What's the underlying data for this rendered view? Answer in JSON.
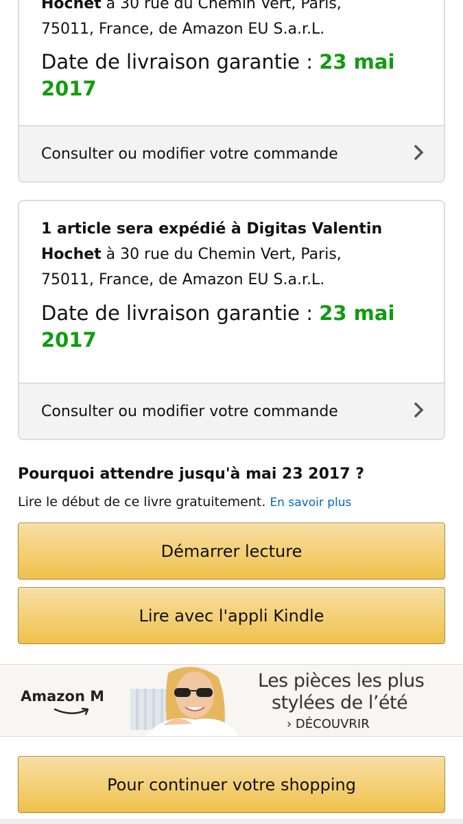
{
  "shipment_1": {
    "line_1_bold": "Hochet",
    "line_1_rest": " à 30 rue du Chemin Vert, Paris,",
    "line_2": "75011, France, de Amazon EU S.a.r.L.",
    "date_label": "Date de livraison garantie : ",
    "date_value_1": "23 mai",
    "date_value_2": "2017",
    "footer_link": "Consulter ou modifier votre commande"
  },
  "shipment_2": {
    "line_1_bold": "1 article sera expédié à Digitas Valentin",
    "line_2_bold": "Hochet",
    "line_2_rest": " à 30 rue du Chemin Vert, Paris,",
    "line_3": "75011, France, de Amazon EU S.a.r.L.",
    "date_label": "Date de livraison garantie : ",
    "date_value_1": "23 mai",
    "date_value_2": "2017",
    "footer_link": "Consulter ou modifier votre commande"
  },
  "kindle_promo": {
    "title": "Pourquoi attendre jusqu'à mai 23 2017 ?",
    "subtitle": "Lire le début de ce livre gratuitement.",
    "learn_more": "En savoir plus",
    "start_reading_button": "Démarrer lecture",
    "kindle_app_button": "Lire avec l'appli Kindle"
  },
  "banner": {
    "brand": "Amazon Mode",
    "headline_1": "Les pièces les plus",
    "headline_2": "stylées de l’été",
    "cta": "› DÉCOUVRIR"
  },
  "continue_button": "Pour continuer votre shopping",
  "colors": {
    "delivery_date_green": "#109c10",
    "link_blue": "#0066c0",
    "button_yellow": "#f0c14b"
  }
}
